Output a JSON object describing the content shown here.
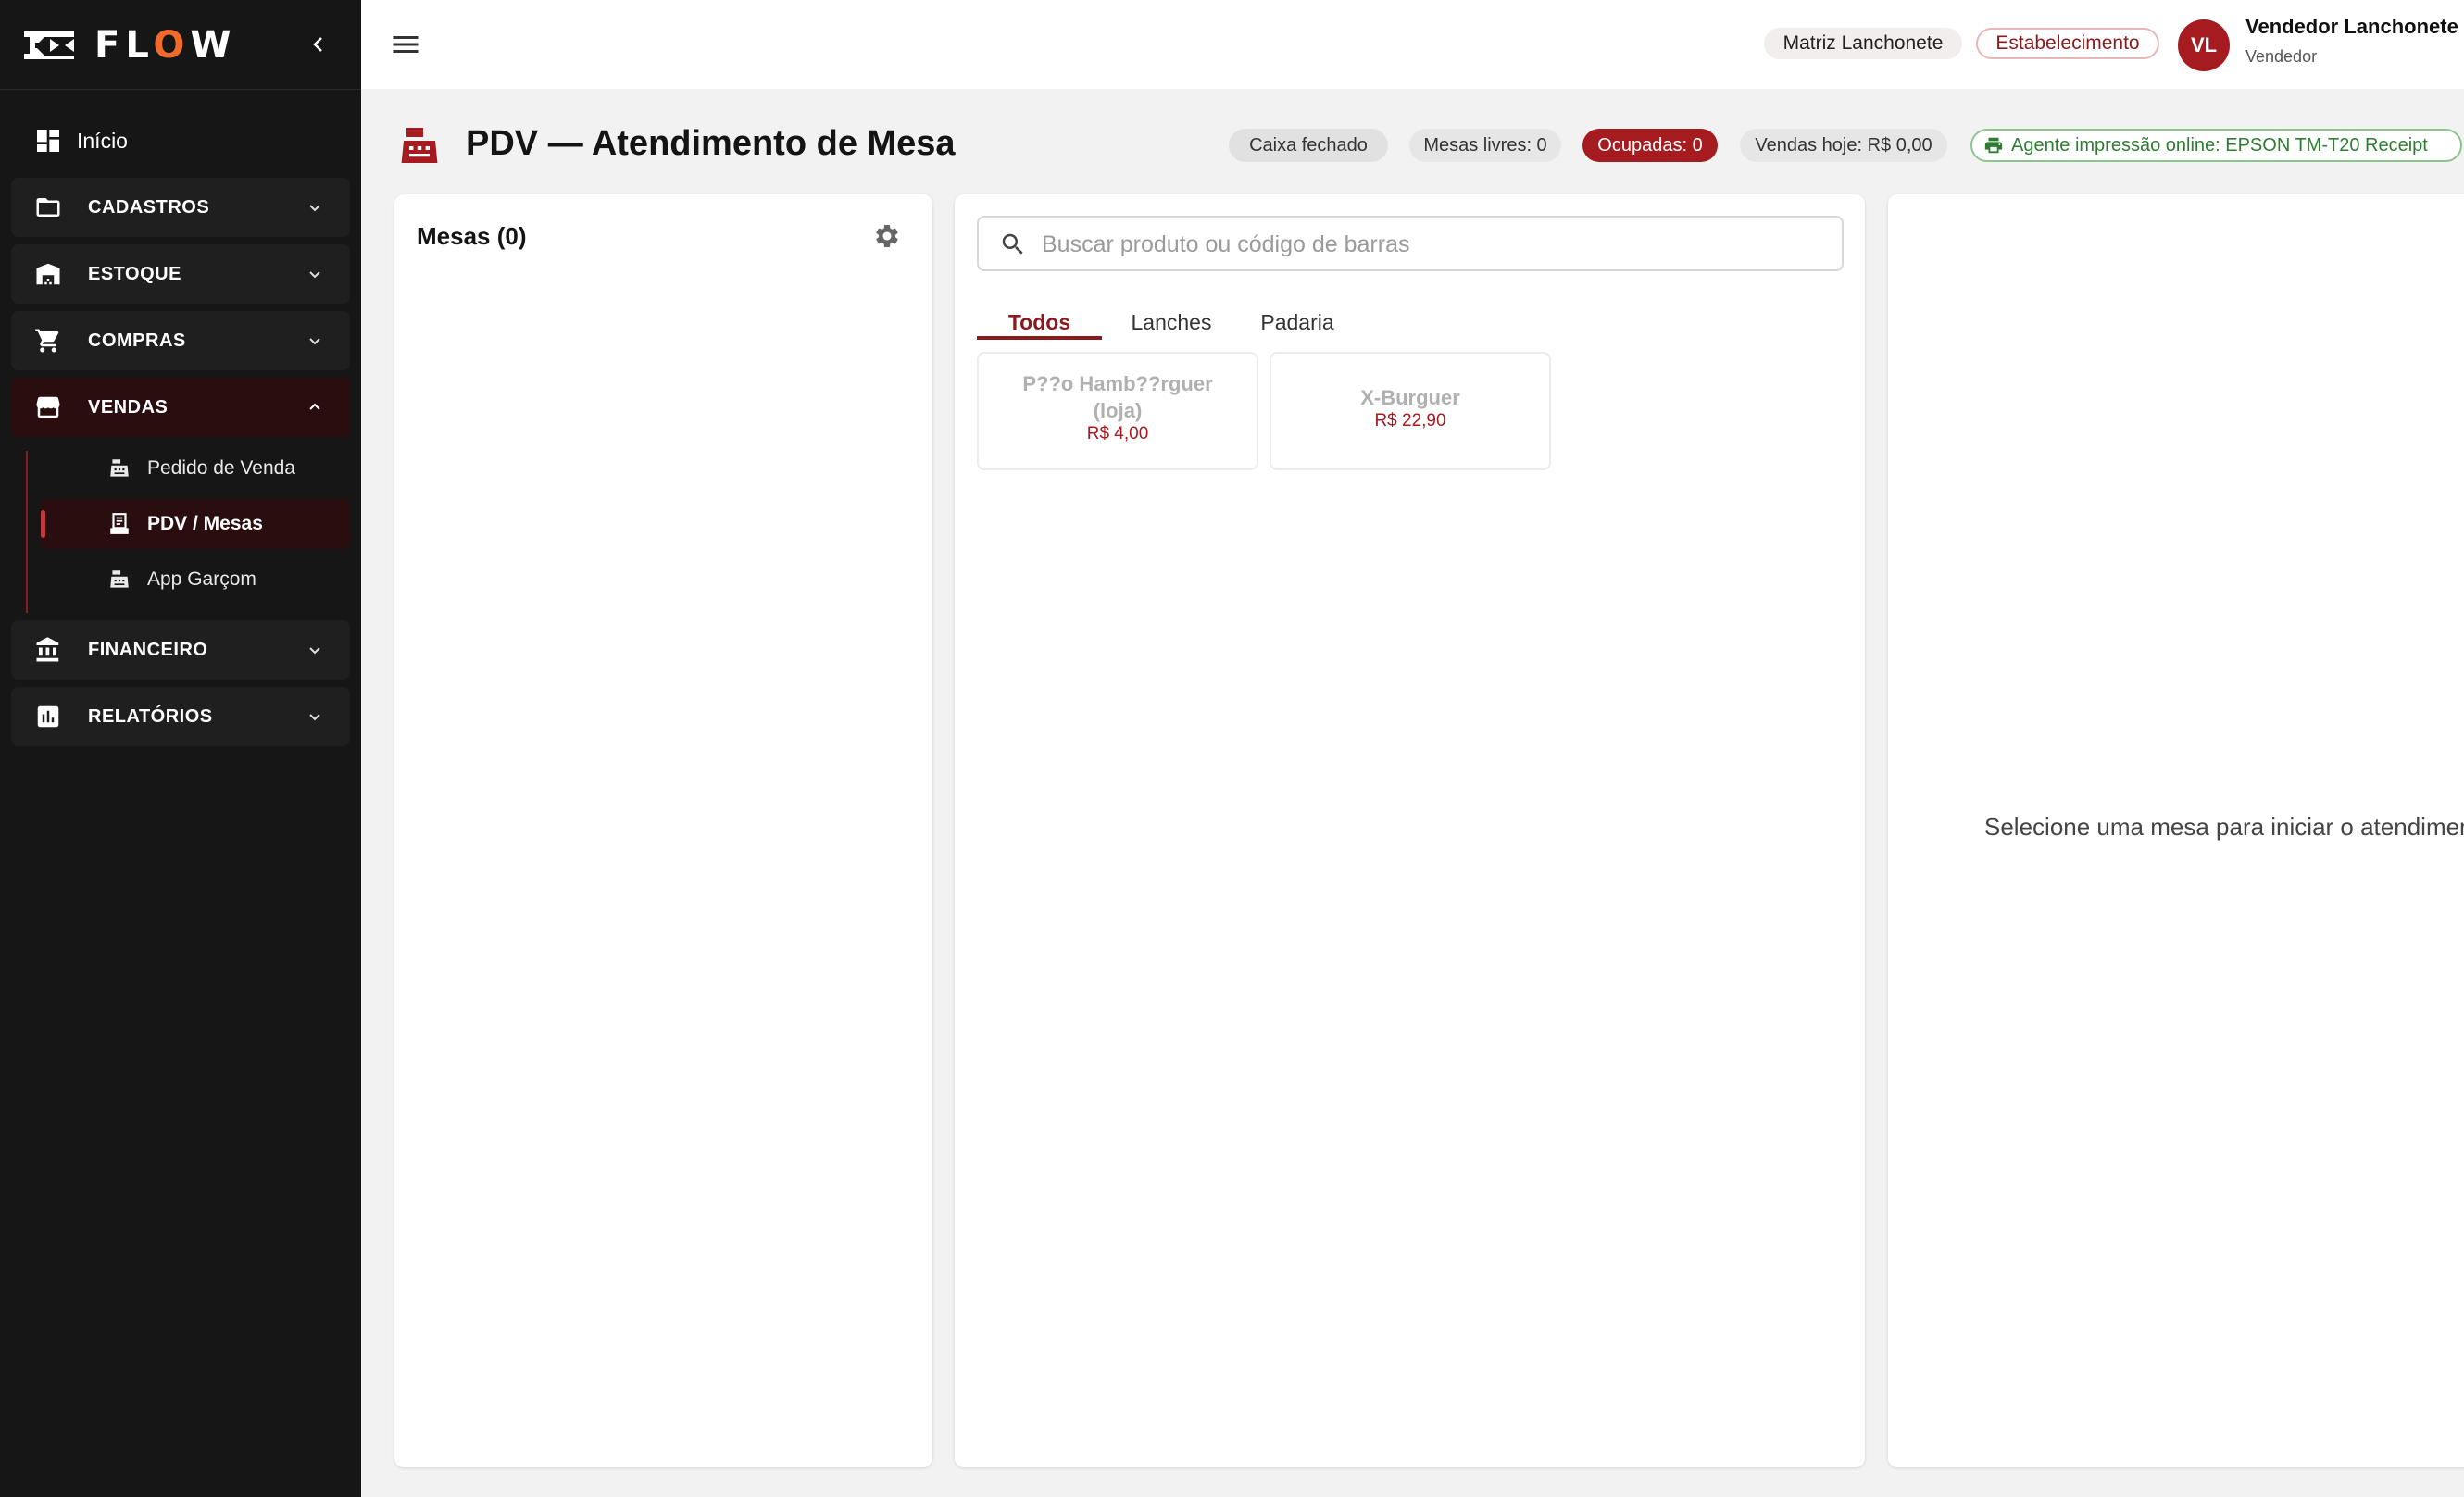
{
  "brand": {
    "name_prefix": "FL",
    "name_o": "O",
    "name_suffix": "W"
  },
  "sidebar": {
    "home": {
      "label": "Início",
      "icon": "dashboard-icon"
    },
    "groups": [
      {
        "label": "CADASTROS",
        "icon": "folder-icon",
        "open": false
      },
      {
        "label": "ESTOQUE",
        "icon": "warehouse-icon",
        "open": false
      },
      {
        "label": "COMPRAS",
        "icon": "cart-icon",
        "open": false
      },
      {
        "label": "VENDAS",
        "icon": "store-icon",
        "open": true
      },
      {
        "label": "FINANCEIRO",
        "icon": "bank-icon",
        "open": false
      },
      {
        "label": "RELATÓRIOS",
        "icon": "chart-icon",
        "open": false
      }
    ],
    "vendas_items": [
      {
        "label": "Pedido de Venda",
        "icon": "cash-register-icon"
      },
      {
        "label": "PDV / Mesas",
        "icon": "receipt-icon",
        "active": true
      },
      {
        "label": "App Garçom",
        "icon": "cash-register-icon"
      }
    ]
  },
  "topbar": {
    "company": "Matriz Lanchonete",
    "establishment_button": "Estabelecimento",
    "user": {
      "initials": "VL",
      "name": "Vendedor Lanchonete",
      "role": "Vendedor"
    }
  },
  "page": {
    "title": "PDV — Atendimento de Mesa",
    "status": {
      "caixa": "Caixa fechado",
      "livres": "Mesas livres: 0",
      "ocupadas": "Ocupadas: 0",
      "vendas": "Vendas hoje: R$ 0,00",
      "agent": "Agente impressão online: EPSON TM-T20 Receipt"
    }
  },
  "mesas": {
    "title": "Mesas (0)"
  },
  "products": {
    "search_placeholder": "Buscar produto ou código de barras",
    "tabs": [
      "Todos",
      "Lanches",
      "Padaria"
    ],
    "active_tab": 0,
    "items": [
      {
        "name_line1": "P??o Hamb??rguer",
        "name_line2": "(loja)",
        "price": "R$ 4,00"
      },
      {
        "name": "X-Burguer",
        "price": "R$ 22,90"
      }
    ]
  },
  "detail": {
    "empty_message": "Selecione uma mesa para iniciar o atendimento"
  },
  "colors": {
    "sidebar_bg": "#161616",
    "accent": "#a51b20",
    "accent_dark": "#8b1a1e",
    "logo_o": "#ef6a2b",
    "success": "#2e7d32"
  }
}
